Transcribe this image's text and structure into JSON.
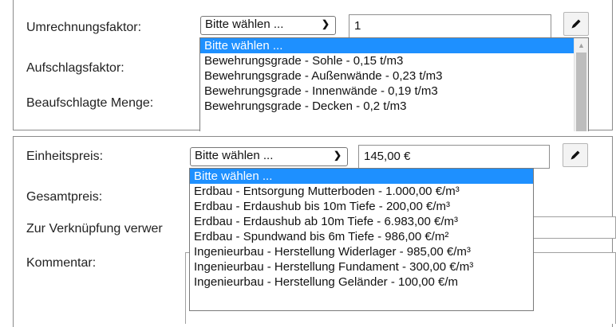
{
  "top_form": {
    "labels": {
      "conversion_factor": "Umrechnungsfaktor:",
      "markup_factor": "Aufschlagsfaktor:",
      "surcharged_quantity": "Beaufschlagte Menge:"
    },
    "select_value": "Bitte wählen ...",
    "factor_value": "1",
    "dropdown_options": [
      "Bitte wählen ...",
      "Bewehrungsgrade - Sohle - 0,15 t/m3",
      "Bewehrungsgrade - Außenwände - 0,23 t/m3",
      "Bewehrungsgrade - Innenwände - 0,19 t/m3",
      "Bewehrungsgrade - Decken - 0,2 t/m3"
    ]
  },
  "bottom_form": {
    "labels": {
      "unit_price": "Einheitspreis:",
      "total_price": "Gesamtpreis:",
      "link_use": "Zur Verknüpfung verwer",
      "comment": "Kommentar:"
    },
    "select_value": "Bitte wählen ...",
    "price_value": "145,00 €",
    "dropdown_options": [
      "Bitte wählen ...",
      "Erdbau - Entsorgung Mutterboden - 1.000,00 €/m³",
      "Erdbau - Erdaushub bis 10m Tiefe - 200,00 €/m³",
      "Erdbau - Erdaushub ab 10m Tiefe - 6.983,00 €/m³",
      "Erdbau - Spundwand bis 6m Tiefe - 986,00 €/m²",
      "Ingenieurbau - Herstellung Widerlager - 985,00 €/m³",
      "Ingenieurbau - Herstellung Fundament - 300,00 €/m³",
      "Ingenieurbau - Herstellung Geländer - 100,00 €/m"
    ]
  },
  "icons": {
    "chevron": "chevron-down-icon",
    "edit": "pencil-icon",
    "scroll_up": "scroll-up-arrow-icon"
  },
  "colors": {
    "selected_option": "#1e90ff",
    "border": "#8a8a8a"
  }
}
